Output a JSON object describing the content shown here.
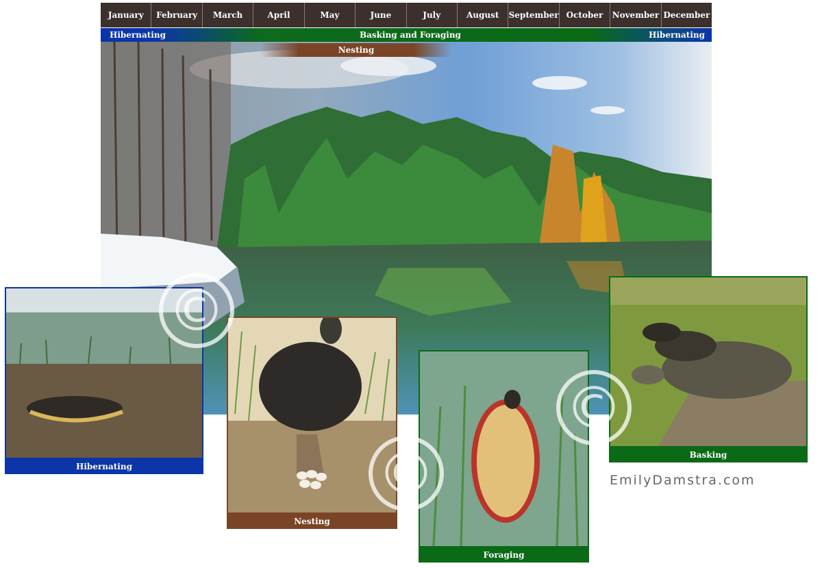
{
  "months": [
    "January",
    "February",
    "March",
    "April",
    "May",
    "June",
    "July",
    "August",
    "September",
    "October",
    "November",
    "December"
  ],
  "activity": {
    "left": "Hibernating",
    "middle": "Basking and Foraging",
    "right": "Hibernating",
    "nesting": "Nesting"
  },
  "panels": {
    "hibernating": {
      "caption": "Hibernating",
      "color": "#0b35a8"
    },
    "nesting": {
      "caption": "Nesting",
      "color": "#7a4526"
    },
    "foraging": {
      "caption": "Foraging",
      "color": "#0a6a16"
    },
    "basking": {
      "caption": "Basking",
      "color": "#0a6a16"
    }
  },
  "watermark": "©",
  "brand": "EmilyDamstra.com"
}
